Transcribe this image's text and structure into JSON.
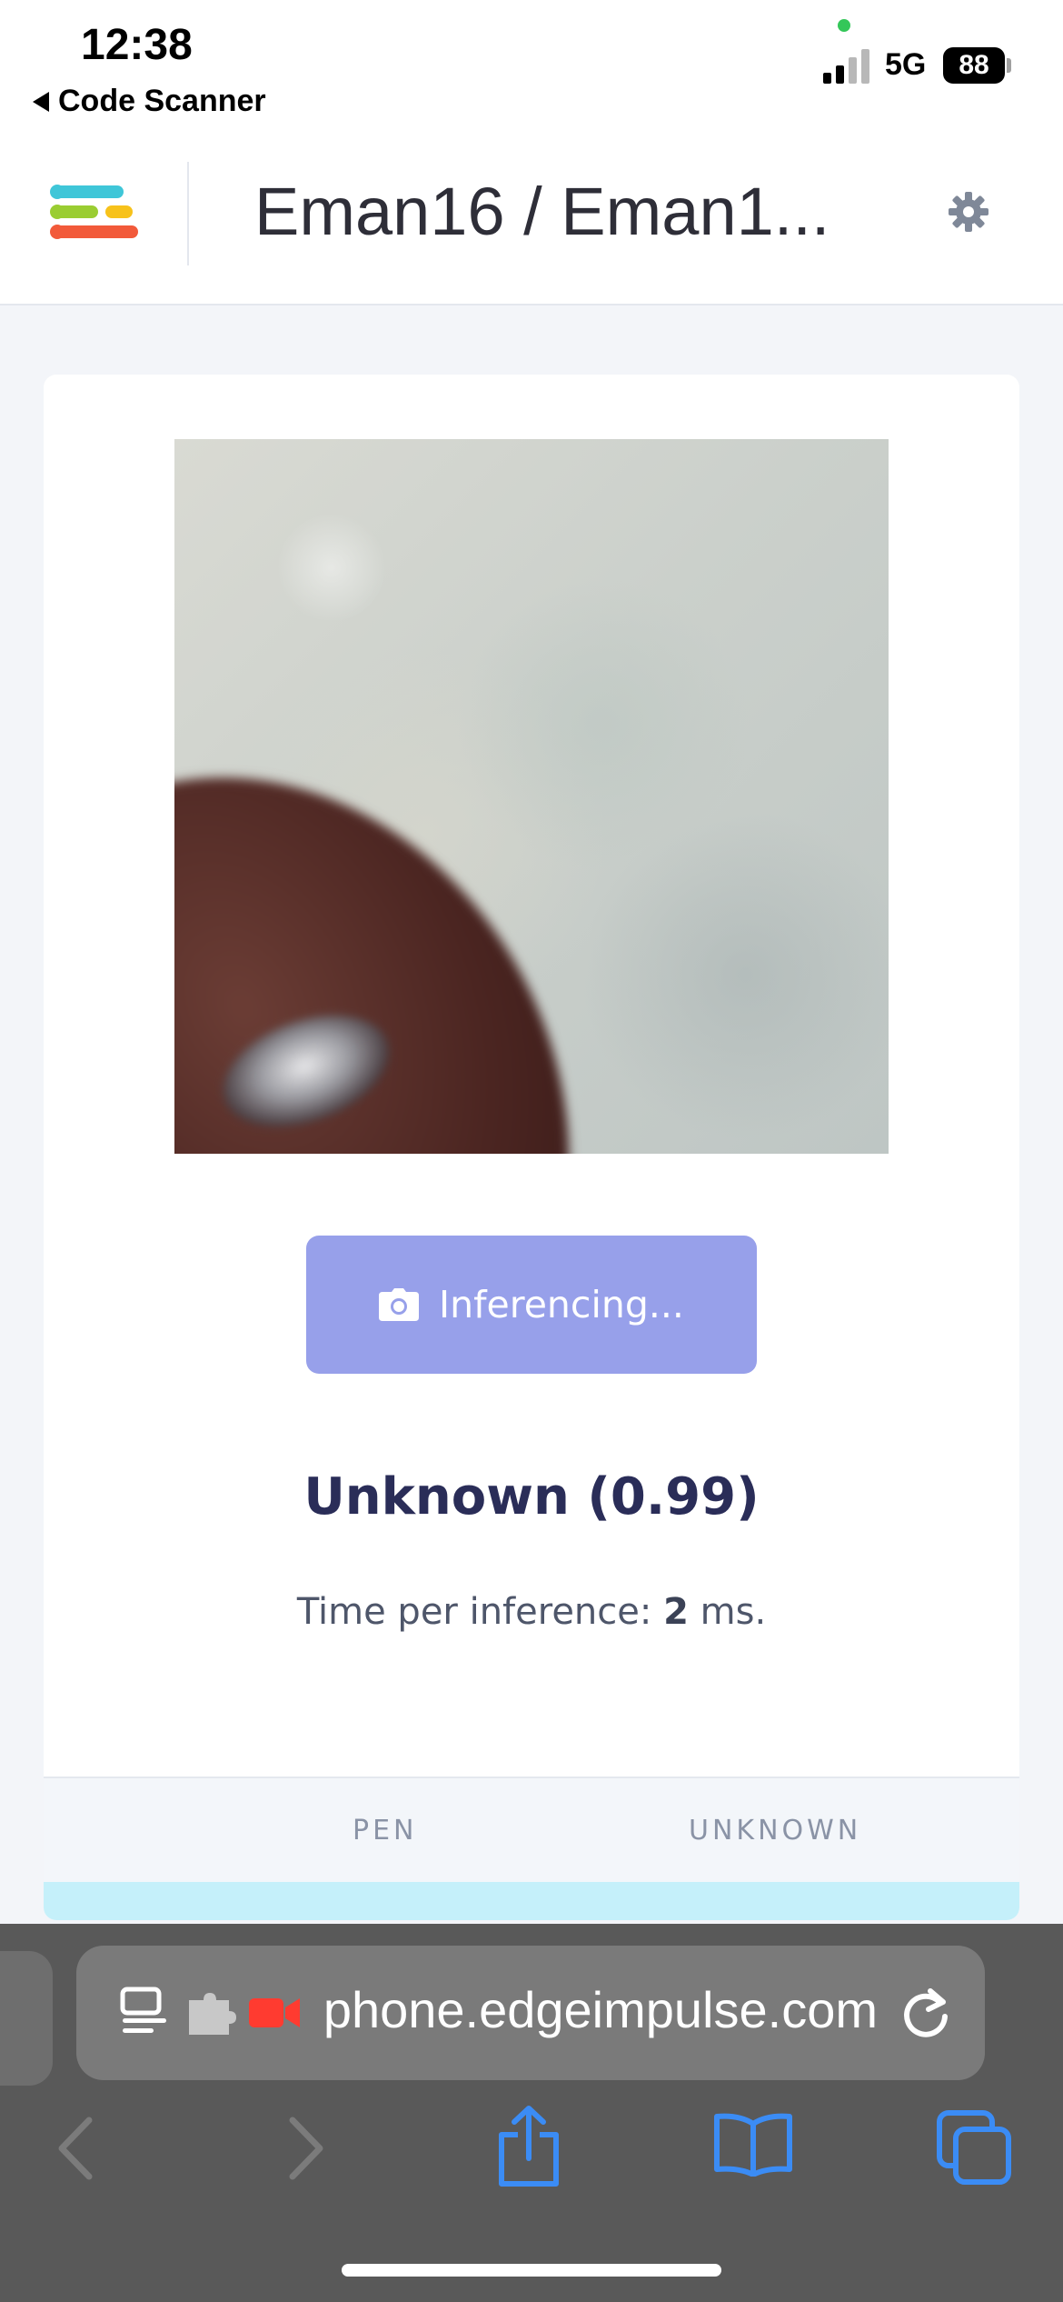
{
  "status_bar": {
    "time": "12:38",
    "back_app_label": "Code Scanner",
    "network": "5G",
    "battery": "88"
  },
  "header": {
    "project_title": "Eman16 / Eman1..."
  },
  "classifier": {
    "button_label": "Inferencing...",
    "result_text": "Unknown (0.99)",
    "timing_prefix": "Time per inference: ",
    "timing_value": "2",
    "timing_suffix": " ms.",
    "table_columns": [
      "PEN",
      "UNKNOWN"
    ]
  },
  "browser": {
    "url_display": "phone.edgeimpulse.com"
  },
  "colors": {
    "button": "#97a0ea",
    "result": "#2a2d58",
    "highlight_row": "#c5f0fa",
    "safari_bar": "#595959"
  }
}
